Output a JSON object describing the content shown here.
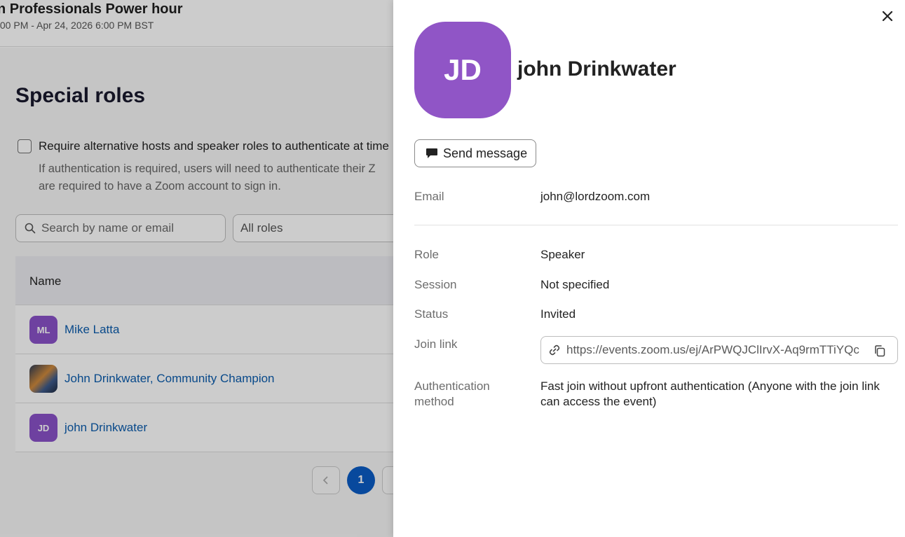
{
  "event": {
    "title": "n Professionals Power hour",
    "time": ":00 PM - Apr 24, 2026 6:00 PM BST"
  },
  "special_roles": {
    "title": "Special roles",
    "auth_checkbox_label": "Require alternative hosts and speaker roles to authenticate at time",
    "auth_help_line1": "If authentication is required, users will need to authenticate their Z",
    "auth_help_line2": "are required to have a Zoom account to sign in.",
    "search_placeholder": "Search by name or email",
    "roles_filter": "All roles",
    "table_header_name": "Name",
    "rows": [
      {
        "initials": "ML",
        "name": "Mike Latta"
      },
      {
        "initials": "",
        "name": "John Drinkwater, Community Champion"
      },
      {
        "initials": "JD",
        "name": "john Drinkwater"
      }
    ],
    "pagination": {
      "current_page": "1"
    }
  },
  "panel": {
    "initials": "JD",
    "name": "john Drinkwater",
    "send_message_label": "Send message",
    "email_label": "Email",
    "email": "john@lordzoom.com",
    "role_label": "Role",
    "role": "Speaker",
    "session_label": "Session",
    "session": "Not specified",
    "status_label": "Status",
    "status": "Invited",
    "join_link_label": "Join link",
    "join_link": "https://events.zoom.us/ej/ArPWQJClIrvX-Aq9rmTTiYQc",
    "auth_method_label_1": "Authentication",
    "auth_method_label_2": "method",
    "auth_method_line1": "Fast join without upfront authentication (Anyone with the join link",
    "auth_method_line2": "can access the event)"
  },
  "colors": {
    "avatar_purple": "#9055c6",
    "link_blue": "#0b5cad",
    "page_active": "#0b5cc5"
  },
  "icons": [
    "search-icon",
    "chevron-left-icon",
    "close-icon",
    "message-icon",
    "link-icon",
    "copy-icon"
  ]
}
